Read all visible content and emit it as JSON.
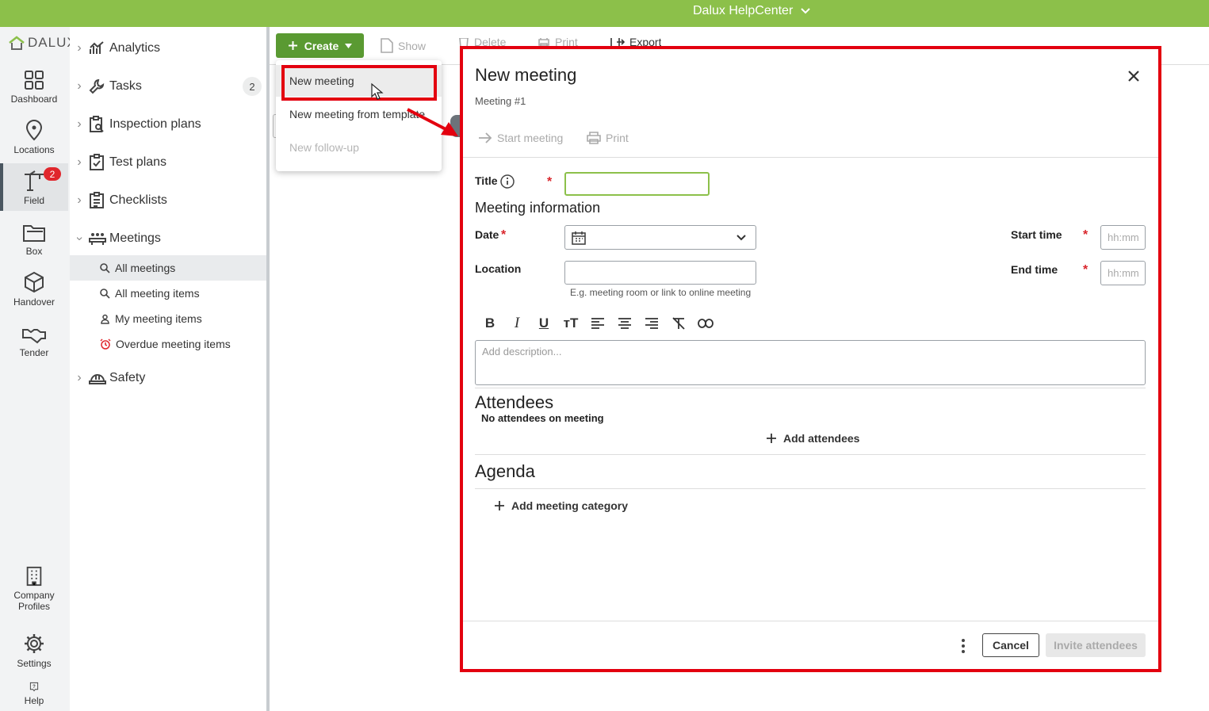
{
  "topbar": {
    "title": "Dalux HelpCenter"
  },
  "brand": {
    "logo_text": "DALUX",
    "accent": "#8cc04a",
    "dark_green": "#5a9a32",
    "highlight_red": "#e3000f"
  },
  "rail": {
    "items": [
      {
        "label": "Dashboard",
        "icon": "grid-icon"
      },
      {
        "label": "Locations",
        "icon": "pin-icon"
      },
      {
        "label": "Field",
        "icon": "crane-icon",
        "badge": "2"
      },
      {
        "label": "Box",
        "icon": "folder-icon"
      },
      {
        "label": "Handover",
        "icon": "cube-icon"
      },
      {
        "label": "Tender",
        "icon": "handshake-icon"
      }
    ],
    "bottom": [
      {
        "label_1": "Company",
        "label_2": "Profiles",
        "icon": "building-icon"
      },
      {
        "label": "Settings",
        "icon": "gear-icon"
      },
      {
        "label": "Help",
        "icon": "help-icon"
      }
    ]
  },
  "nav": {
    "items": [
      {
        "label": "Analytics"
      },
      {
        "label": "Tasks",
        "count": "2"
      },
      {
        "label": "Inspection plans"
      },
      {
        "label": "Test plans"
      },
      {
        "label": "Checklists"
      },
      {
        "label": "Meetings"
      },
      {
        "label": "Safety"
      }
    ],
    "meetings_sub": [
      {
        "label": "All meetings"
      },
      {
        "label": "All meeting items"
      },
      {
        "label": "My meeting items"
      },
      {
        "label": "Overdue meeting items"
      }
    ]
  },
  "toolbar": {
    "create": "Create",
    "show": "Show",
    "delete": "Delete",
    "print": "Print",
    "export": "Export"
  },
  "dropdown": {
    "new_meeting": "New meeting",
    "from_template": "New meeting from template",
    "follow_up": "New follow-up"
  },
  "modal": {
    "title": "New meeting",
    "subtitle": "Meeting #1",
    "start_meeting": "Start meeting",
    "print": "Print",
    "title_label": "Title",
    "meeting_info": "Meeting information",
    "date_label": "Date",
    "location_label": "Location",
    "location_hint": "E.g. meeting room or link to online meeting",
    "start_time_label": "Start time",
    "end_time_label": "End time",
    "time_placeholder": "hh:mm",
    "description_placeholder": "Add description...",
    "attendees_heading": "Attendees",
    "no_attendees": "No attendees on meeting",
    "add_attendees": "Add attendees",
    "agenda_heading": "Agenda",
    "add_category": "Add meeting category",
    "cancel": "Cancel",
    "invite": "Invite attendees"
  }
}
